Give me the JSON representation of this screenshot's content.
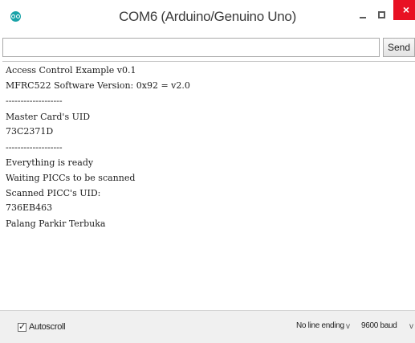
{
  "window": {
    "title": "COM6 (Arduino/Genuino Uno)",
    "icon": "arduino-icon",
    "controls": {
      "minimize": "minimize-icon",
      "maximize": "maximize-icon",
      "close": "×"
    }
  },
  "toolbar": {
    "input_value": "",
    "send_label": "Send"
  },
  "output": {
    "lines": [
      "Access Control Example v0.1",
      "MFRC522 Software Version: 0x92 = v2.0",
      "-------------------",
      "Master Card's UID",
      "73C2371D",
      "-------------------",
      "Everything is ready",
      "Waiting PICCs to be scanned",
      "Scanned PICC's UID:",
      "736EB463",
      "Palang Parkir Terbuka"
    ]
  },
  "status": {
    "autoscroll_checked": true,
    "autoscroll_label": "Autoscroll",
    "line_ending": "No line ending",
    "baud": "9600 baud",
    "chevron": "v"
  },
  "colors": {
    "close_button": "#e81123",
    "app_icon": "#1ba3a8"
  }
}
